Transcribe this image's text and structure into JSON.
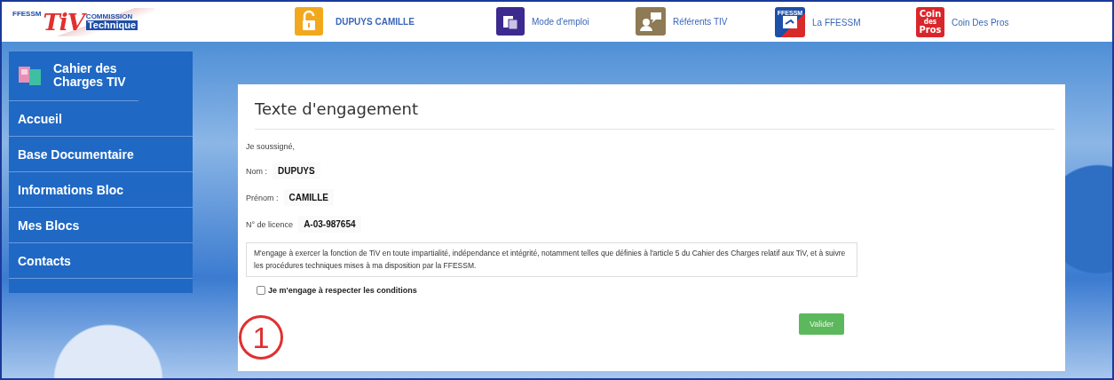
{
  "logo": {
    "org": "FFESSM",
    "name": "TiV",
    "line1": "COMMISSION",
    "line2": "Technique"
  },
  "nav": [
    {
      "kind": "user",
      "label": "DUPUYS CAMILLE"
    },
    {
      "kind": "guide",
      "label": "Mode d'emploi"
    },
    {
      "kind": "referents",
      "label": "Référents TIV"
    },
    {
      "kind": "ffessm",
      "label": "La FFESSM",
      "badge": "FFESSM"
    },
    {
      "kind": "pros",
      "label": "Coin Des Pros",
      "badge": [
        "Coin",
        "des",
        "Pros"
      ]
    }
  ],
  "sidebar": {
    "title": "Cahier des Charges TIV",
    "items": [
      "Accueil",
      "Base Documentaire",
      "Informations Bloc",
      "Mes Blocs",
      "Contacts"
    ]
  },
  "form": {
    "title": "Texte d'engagement",
    "intro": "Je soussigné,",
    "fields": [
      {
        "label": "Nom :",
        "value": "DUPUYS"
      },
      {
        "label": "Prénom :",
        "value": "CAMILLE"
      },
      {
        "label": "N° de licence",
        "value": "A-03-987654"
      }
    ],
    "statement": "M'engage à exercer la fonction de TiV en toute impartialité, indépendance et intégrité, notamment telles que définies à l'article 5 du Cahier des Charges relatif aux TiV, et à suivre les procédures techniques mises à ma disposition par la FFESSM.",
    "agree": {
      "label": "Je m'engage à respecter les conditions",
      "checked": false
    },
    "submit": "Valider"
  },
  "callout": "1"
}
